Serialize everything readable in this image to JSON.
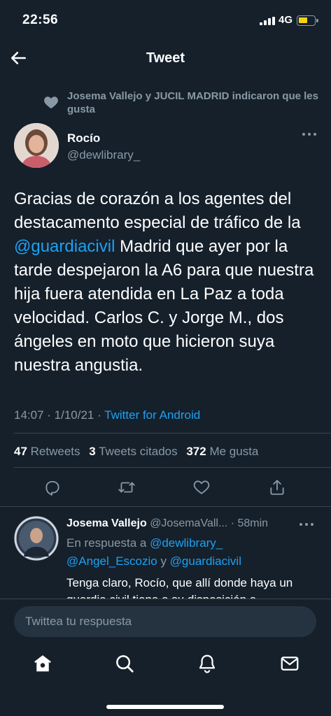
{
  "status_bar": {
    "time": "22:56",
    "network": "4G"
  },
  "header": {
    "title": "Tweet"
  },
  "social_context": {
    "text": "Josema Vallejo y JUCIL MADRID indicaron que les gusta"
  },
  "tweet": {
    "author_name": "Rocío",
    "author_handle": "@dewlibrary_",
    "text_before": "Gracias de corazón a los agentes del destacamento especial de tráfico de la ",
    "mention": "@guardiacivil",
    "text_after": " Madrid que ayer por la tarde despejaron la A6 para que nuestra hija fuera atendida en La Paz a toda velocidad. Carlos C. y Jorge M., dos ángeles en moto que hicieron suya nuestra angustia.",
    "timestamp": "14:07 · 1/10/21 · ",
    "source": "Twitter for Android",
    "stats": {
      "retweets_count": "47",
      "retweets_label": "Retweets",
      "quotes_count": "3",
      "quotes_label": "Tweets citados",
      "likes_count": "372",
      "likes_label": "Me gusta"
    }
  },
  "actions": [
    "reply-icon",
    "retweet-icon",
    "like-icon",
    "share-icon"
  ],
  "reply": {
    "author_name": "Josema Vallejo",
    "author_handle": "@JosemaVall...",
    "time": "58min",
    "in_reply_prefix": "En respuesta a ",
    "in_reply_mention1": "@dewlibrary_",
    "in_reply_mention2": "@Angel_Escozio",
    "in_reply_and": " y ",
    "in_reply_mention3": "@guardiacivil",
    "text": "Tenga claro, Rocío, que allí donde haya un guardia civil tiene a su disposición a"
  },
  "compose": {
    "placeholder": "Twittea tu respuesta"
  },
  "tabs": [
    "home-icon",
    "search-icon",
    "notifications-icon",
    "messages-icon"
  ],
  "colors": {
    "background": "#15202b",
    "accent": "#1da1f2",
    "muted": "#8899a6",
    "divider": "#38444d",
    "battery": "#f5d40f"
  }
}
